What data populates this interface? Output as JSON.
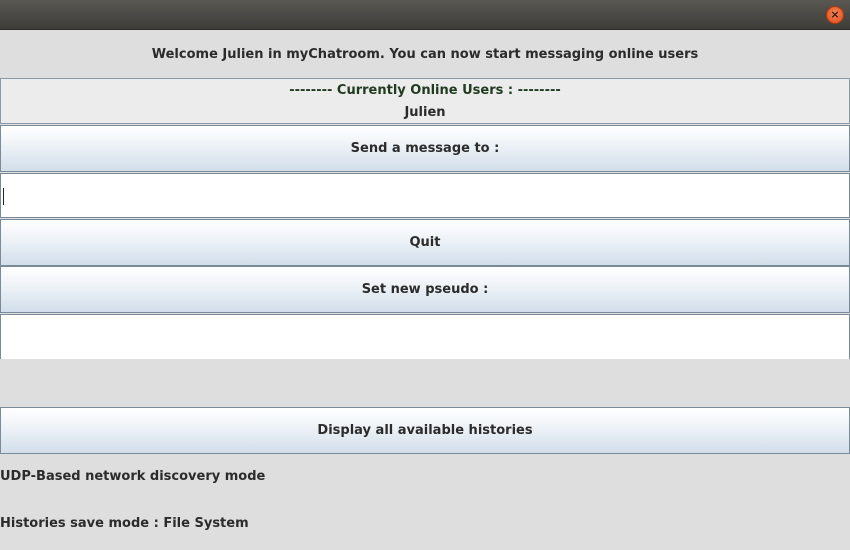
{
  "window": {
    "close_glyph": "×"
  },
  "welcome_text": "Welcome Julien in myChatroom. You can now start messaging online users",
  "online": {
    "header": "-------- Currently Online Users : --------",
    "users": [
      "Julien"
    ]
  },
  "send_button_label": "Send a message to :",
  "message_input": {
    "value": "",
    "placeholder": ""
  },
  "quit_button_label": "Quit",
  "set_pseudo_button_label": "Set new pseudo :",
  "pseudo_input": {
    "value": "",
    "placeholder": ""
  },
  "histories_button_label": "Display all available histories",
  "discovery_mode_text": "UDP-Based network discovery mode",
  "save_mode_text": "Histories save mode : File System"
}
